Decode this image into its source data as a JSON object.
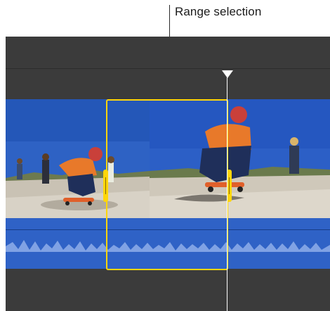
{
  "callout": {
    "label": "Range selection"
  },
  "colors": {
    "timeline_bg": "#3b3b3b",
    "video_sky": "#2f64c9",
    "audio_track": "#2f62c6",
    "waveform": "#9cb8ee",
    "selection": "#ffd60a",
    "playhead": "#ffffff"
  },
  "icons": {
    "playhead": "downward-triangle",
    "selection_handle": "vertical-bar"
  }
}
